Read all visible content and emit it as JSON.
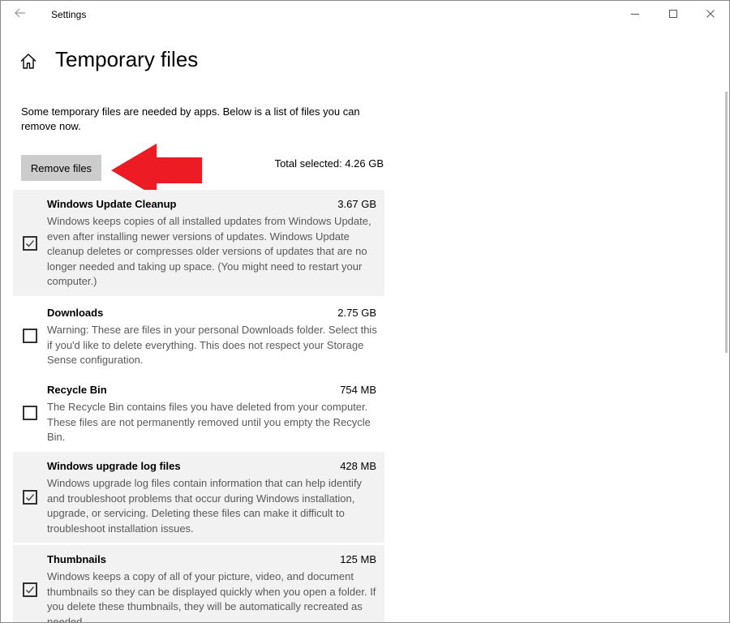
{
  "window": {
    "title": "Settings"
  },
  "page": {
    "title": "Temporary files",
    "intro": "Some temporary files are needed by apps. Below is a list of files you can remove now.",
    "remove_button": "Remove files",
    "total_selected": "Total selected: 4.26 GB"
  },
  "items": [
    {
      "name": "Windows Update Cleanup",
      "size": "3.67 GB",
      "checked": true,
      "description": "Windows keeps copies of all installed updates from Windows Update, even after installing newer versions of updates. Windows Update cleanup deletes or compresses older versions of updates that are no longer needed and taking up space. (You might need to restart your computer.)"
    },
    {
      "name": "Downloads",
      "size": "2.75 GB",
      "checked": false,
      "description": "Warning: These are files in your personal Downloads folder. Select this if you'd like to delete everything. This does not respect your Storage Sense configuration."
    },
    {
      "name": "Recycle Bin",
      "size": "754 MB",
      "checked": false,
      "description": "The Recycle Bin contains files you have deleted from your computer. These files are not permanently removed until you empty the Recycle Bin."
    },
    {
      "name": "Windows upgrade log files",
      "size": "428 MB",
      "checked": true,
      "description": "Windows upgrade log files contain information that can help identify and troubleshoot problems that occur during Windows installation, upgrade, or servicing.  Deleting these files can make it difficult to troubleshoot installation issues."
    },
    {
      "name": "Thumbnails",
      "size": "125 MB",
      "checked": true,
      "description": "Windows keeps a copy of all of your picture, video, and document thumbnails so they can be displayed quickly when you open a folder. If you delete these thumbnails, they will be automatically recreated as needed."
    }
  ],
  "colors": {
    "arrow": "#ed1c24",
    "selected_row_bg": "#f2f2f2",
    "button_bg": "#cccccc",
    "description_text": "#595959"
  },
  "icons": {
    "back": "back-arrow-icon",
    "home": "home-icon",
    "minimize": "minimize-icon",
    "maximize": "maximize-icon",
    "close": "close-icon",
    "check": "checkmark-icon"
  }
}
